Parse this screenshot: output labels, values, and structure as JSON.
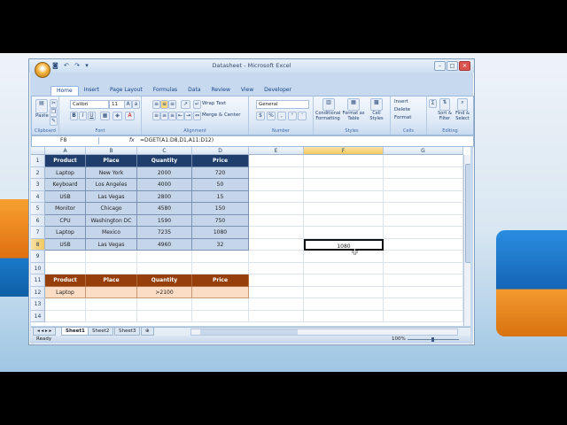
{
  "window": {
    "title": "Datasheet - Microsoft Excel",
    "quick_access": "◙ ↶ ↷ ▾"
  },
  "ribbon": {
    "tabs": [
      "Home",
      "Insert",
      "Page Layout",
      "Formulas",
      "Data",
      "Review",
      "View",
      "Developer"
    ],
    "active_tab": "Home",
    "clipboard": {
      "label": "Clipboard",
      "paste": "Paste"
    },
    "font": {
      "label": "Font",
      "family": "Calibri",
      "size": "11",
      "bold": "B",
      "italic": "I",
      "underline": "U"
    },
    "alignment": {
      "label": "Alignment",
      "wrap": "Wrap Text",
      "merge": "Merge & Center"
    },
    "number": {
      "label": "Number",
      "format": "General",
      "currency": "$",
      "percent": "%",
      "comma": ","
    },
    "styles": {
      "label": "Styles",
      "conditional": "Conditional Formatting",
      "format_table": "Format as Table",
      "cell_styles": "Cell Styles"
    },
    "cells": {
      "label": "Cells",
      "insert": "Insert",
      "delete": "Delete",
      "format": "Format"
    },
    "editing": {
      "label": "Editing",
      "sort": "Sort & Filter",
      "find": "Find & Select",
      "sum": "Σ"
    }
  },
  "formula_bar": {
    "name_box": "F8",
    "fx": "fx",
    "formula": "=DGET(A1:D8,D1,A11:D12)"
  },
  "columns": [
    "A",
    "B",
    "C",
    "D",
    "E",
    "F",
    "G"
  ],
  "selected_column": "F",
  "rows": [
    "1",
    "2",
    "3",
    "4",
    "5",
    "6",
    "7",
    "8",
    "9",
    "10",
    "11",
    "12",
    "13",
    "14"
  ],
  "selected_row": "8",
  "database": {
    "headers": [
      "Product",
      "Place",
      "Quantity",
      "Price"
    ],
    "rows": [
      [
        "Laptop",
        "New York",
        "2000",
        "720"
      ],
      [
        "Keyboard",
        "Los Angeles",
        "4000",
        "50"
      ],
      [
        "USB",
        "Las Vegas",
        "2800",
        "15"
      ],
      [
        "Monitor",
        "Chicago",
        "4580",
        "150"
      ],
      [
        "CPU",
        "Washington DC",
        "1590",
        "750"
      ],
      [
        "Laptop",
        "Mexico",
        "7235",
        "1080"
      ],
      [
        "USB",
        "Las Vegas",
        "4960",
        "32"
      ]
    ]
  },
  "criteria": {
    "headers": [
      "Product",
      "Place",
      "Quantity",
      "Price"
    ],
    "row": [
      "Laptop",
      "",
      ">2100",
      ""
    ]
  },
  "result_cell": {
    "address": "F8",
    "value": "1080"
  },
  "sheets": [
    "Sheet1",
    "Sheet2",
    "Sheet3"
  ],
  "active_sheet": "Sheet1",
  "status": {
    "ready": "Ready",
    "zoom": "100%"
  }
}
